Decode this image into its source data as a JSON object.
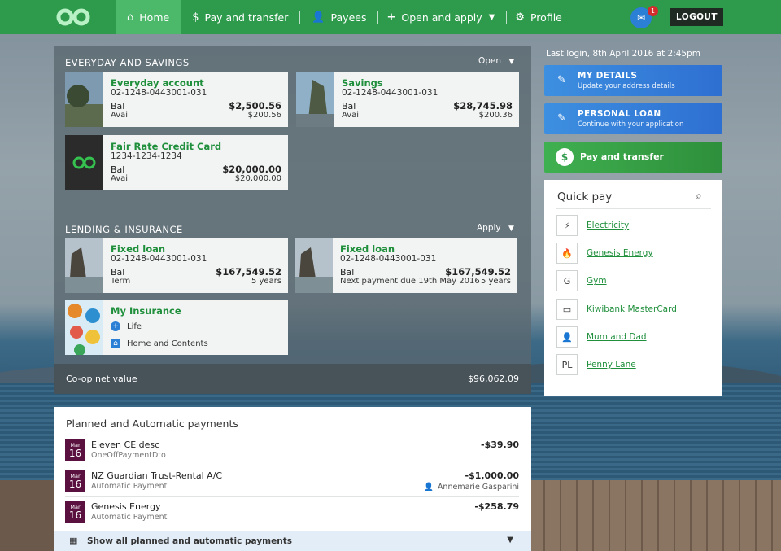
{
  "nav": {
    "items": [
      {
        "label": "Home",
        "icon": "home-icon"
      },
      {
        "label": "Pay and transfer",
        "icon": "dollar-icon"
      },
      {
        "label": "Payees",
        "icon": "person-icon"
      },
      {
        "label": "Open and apply",
        "icon": "plus-icon"
      },
      {
        "label": "Profile",
        "icon": "gear-icon"
      }
    ],
    "mail_badge": "1",
    "logout_label": "LOGOUT"
  },
  "everyday": {
    "heading": "EVERYDAY AND SAVINGS",
    "action": "Open",
    "accounts": [
      {
        "name": "Everyday account",
        "number": "02-1248-0443001-031",
        "bal_label": "Bal",
        "bal": "$2,500.56",
        "avail_label": "Avail",
        "avail": "$200.56"
      },
      {
        "name": "Savings",
        "number": "02-1248-0443001-031",
        "bal_label": "Bal",
        "bal": "$28,745.98",
        "avail_label": "Avail",
        "avail": "$200.36"
      },
      {
        "name": "Fair Rate Credit Card",
        "number": "1234-1234-1234",
        "bal_label": "Bal",
        "bal": "$20,000.00",
        "avail_label": "Avail",
        "avail": "$20,000.00"
      }
    ]
  },
  "lending": {
    "heading": "LENDING & INSURANCE",
    "action": "Apply",
    "loans": [
      {
        "name": "Fixed loan",
        "number": "02-1248-0443001-031",
        "bal_label": "Bal",
        "bal": "$167,549.52",
        "sub_label": "Term",
        "sub_value": "5 years"
      },
      {
        "name": "Fixed loan",
        "number": "02-1248-0443001-031",
        "bal_label": "Bal",
        "bal": "$167,549.52",
        "sub_label": "Next payment due 19th May 2016",
        "sub_value": "5 years"
      }
    ],
    "insurance": {
      "name": "My Insurance",
      "items": [
        "Life",
        "Home and Contents"
      ]
    }
  },
  "net": {
    "label": "Co-op net value",
    "value": "$96,062.09"
  },
  "side": {
    "last_login": "Last login, 8th April 2016 at 2:45pm",
    "details": {
      "title": "MY DETAILS",
      "subtitle": "Update your address details"
    },
    "loan": {
      "title": "PERSONAL LOAN",
      "subtitle": "Continue with your application"
    },
    "pay": {
      "title": "Pay and transfer"
    }
  },
  "quickpay": {
    "title": "Quick pay",
    "payees": [
      {
        "name": "Electricity",
        "icon": "bolt-icon",
        "glyph": "⚡"
      },
      {
        "name": "Genesis Energy",
        "icon": "flame-icon",
        "glyph": "🔥"
      },
      {
        "name": "Gym",
        "icon": "letter-g-icon",
        "glyph": "G"
      },
      {
        "name": "Kiwibank MasterCard",
        "icon": "card-icon",
        "glyph": "▭"
      },
      {
        "name": "Mum and Dad",
        "icon": "person-icon",
        "glyph": "👤"
      },
      {
        "name": "Penny Lane",
        "icon": "initials-pl-icon",
        "glyph": "PL"
      }
    ]
  },
  "planned": {
    "title": "Planned and Automatic payments",
    "rows": [
      {
        "month": "Mar",
        "day": "16",
        "name": "Eleven CE desc",
        "type": "OneOffPaymentDto",
        "amount": "-$39.90",
        "payee": ""
      },
      {
        "month": "Mar",
        "day": "16",
        "name": "NZ Guardian Trust-Rental A/C",
        "type": "Automatic Payment",
        "amount": "-$1,000.00",
        "payee": "Annemarie Gasparini"
      },
      {
        "month": "Mar",
        "day": "16",
        "name": "Genesis Energy",
        "type": "Automatic Payment",
        "amount": "-$258.79",
        "payee": ""
      }
    ],
    "show_all": "Show all planned and automatic payments"
  }
}
